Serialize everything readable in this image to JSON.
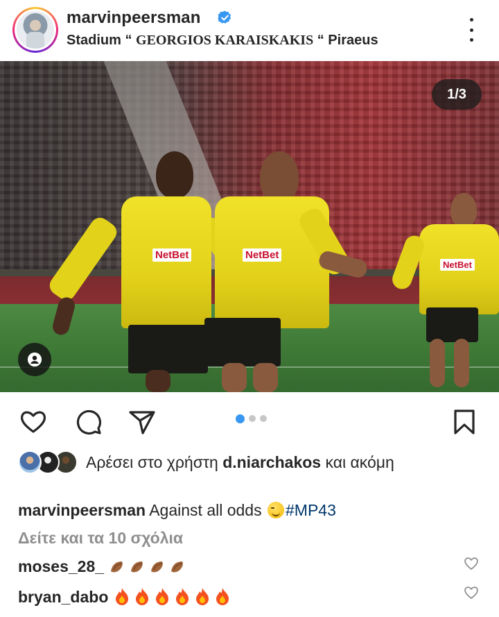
{
  "header": {
    "username": "marvinpeersman",
    "location_prefix": "Stadium “ ",
    "location_name": "GEORGIOS KARAISKAKIS",
    "location_suffix": " “ Piraeus"
  },
  "photo": {
    "counter": "1/3",
    "sponsor": "NetBet"
  },
  "carousel": {
    "total": 3,
    "current": 1
  },
  "likes": {
    "prefix": "Αρέσει στο χρήστη ",
    "user": "d.niarchakos",
    "suffix": " και ακόμη"
  },
  "caption": {
    "user": "marvinpeersman",
    "text": " Against all odds ",
    "hashtag": "#MP43"
  },
  "view_comments": "Δείτε και τα 10 σχόλια",
  "comments": [
    {
      "user": "moses_28_",
      "emoji": "clapping-hands x4"
    },
    {
      "user": "bryan_dabo",
      "emoji": "fire x6"
    }
  ],
  "colors": {
    "verified": "#3897f0",
    "active_dot": "#3897f0",
    "hashtag": "#00376b",
    "muted": "#8e8e8e"
  },
  "icons": [
    "verified-badge-icon",
    "more-options-icon",
    "user-tag-icon",
    "heart-icon",
    "comment-icon",
    "share-icon",
    "bookmark-icon"
  ]
}
